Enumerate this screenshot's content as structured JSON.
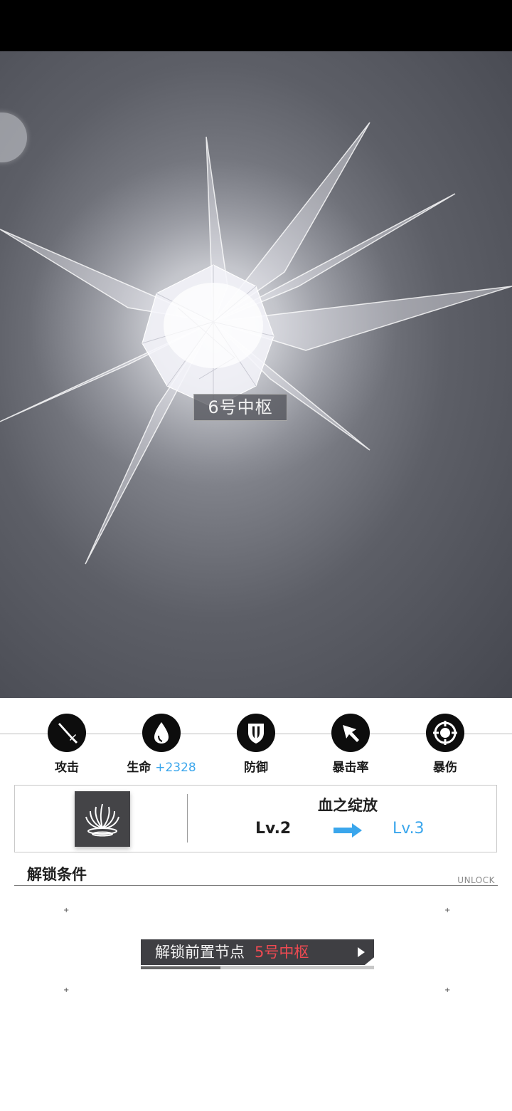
{
  "node_title": "6号中枢",
  "stats": [
    {
      "label": "攻击",
      "value": "",
      "icon": "sword-icon"
    },
    {
      "label": "生命",
      "value": "+2328",
      "icon": "blood-drop-icon"
    },
    {
      "label": "防御",
      "value": "",
      "icon": "shield-icon"
    },
    {
      "label": "暴击率",
      "value": "",
      "icon": "cursor-arrow-icon"
    },
    {
      "label": "暴伤",
      "value": "",
      "icon": "crosshair-icon"
    }
  ],
  "skill": {
    "name": "血之绽放",
    "level_from": "Lv.2",
    "level_to": "Lv.3",
    "icon": "blood-bloom-icon"
  },
  "unlock_section": {
    "title": "解锁条件",
    "subtitle": "UNLOCK",
    "button_label": "解锁前置节点",
    "button_node": "5号中枢"
  },
  "colors": {
    "accent_blue": "#3aa6ec",
    "accent_red": "#ee4a52",
    "dark_panel": "#3f3f43"
  }
}
